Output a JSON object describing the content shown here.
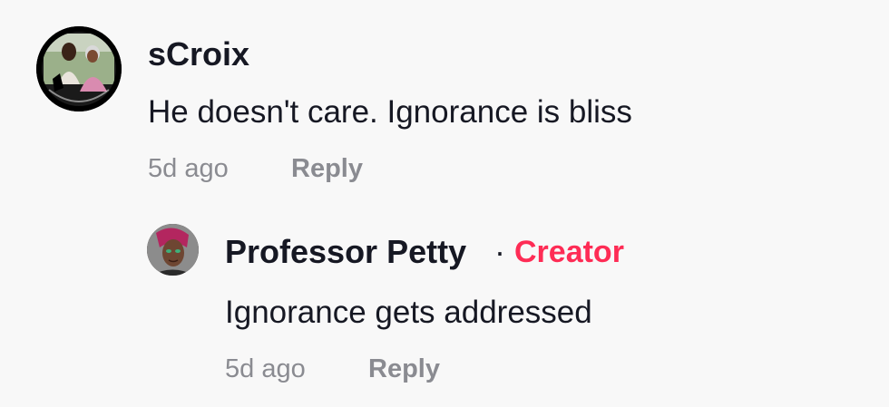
{
  "comment": {
    "username": "sCroix",
    "text": "He doesn't care. Ignorance is bliss",
    "timestamp": "5d ago",
    "reply_label": "Reply",
    "avatar_icon": "user-avatar-photo"
  },
  "reply": {
    "username": "Professor Petty",
    "separator": "·",
    "badge": "Creator",
    "text": "Ignorance gets addressed",
    "timestamp": "5d ago",
    "reply_label": "Reply",
    "avatar_icon": "creator-avatar-photo"
  },
  "colors": {
    "background": "#f8f8f8",
    "text_primary": "#161823",
    "text_secondary": "#8a8b91",
    "creator_accent": "#fe2c55"
  }
}
